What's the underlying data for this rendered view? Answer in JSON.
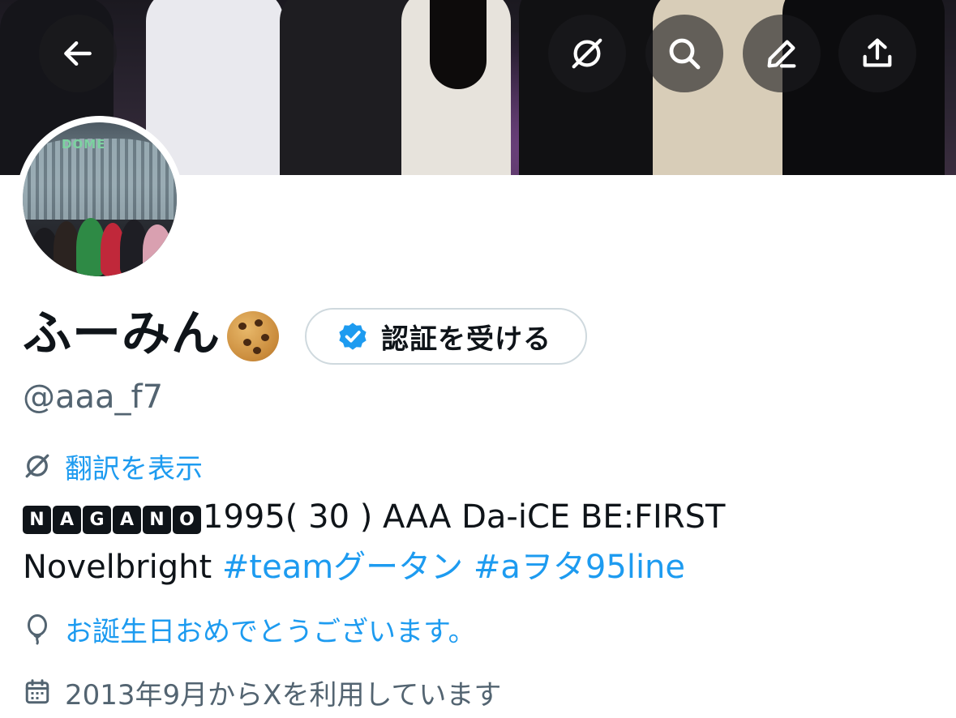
{
  "header": {
    "back_icon": "arrow-left-icon",
    "translate_icon": "translate-off-icon",
    "search_icon": "search-icon",
    "edit_icon": "pencil-icon",
    "share_icon": "share-upload-icon"
  },
  "avatar": {
    "sign_text": "DOME"
  },
  "profile": {
    "display_name": "ふーみん",
    "name_emoji": "cookie",
    "verify_button_label": "認証を受ける",
    "handle": "@aaa_f7",
    "translate_label": "翻訳を表示",
    "bio": {
      "boxed_letters": [
        "N",
        "A",
        "G",
        "A",
        "N",
        "O"
      ],
      "text_after_boxes": "1995( 30 ) AAA Da-iCE BE:FIRST",
      "line2_text": "Novelbright",
      "hashtags": [
        "#teamグータン",
        "#aヲタ95line"
      ]
    },
    "birthday_text": "お誕生日おめでとうございます。",
    "joined_text": "2013年9月からXを利用しています"
  },
  "colors": {
    "accent": "#1d9bf0",
    "secondary_text": "#536471",
    "primary_text": "#0f1419",
    "border": "#cfd9de"
  }
}
